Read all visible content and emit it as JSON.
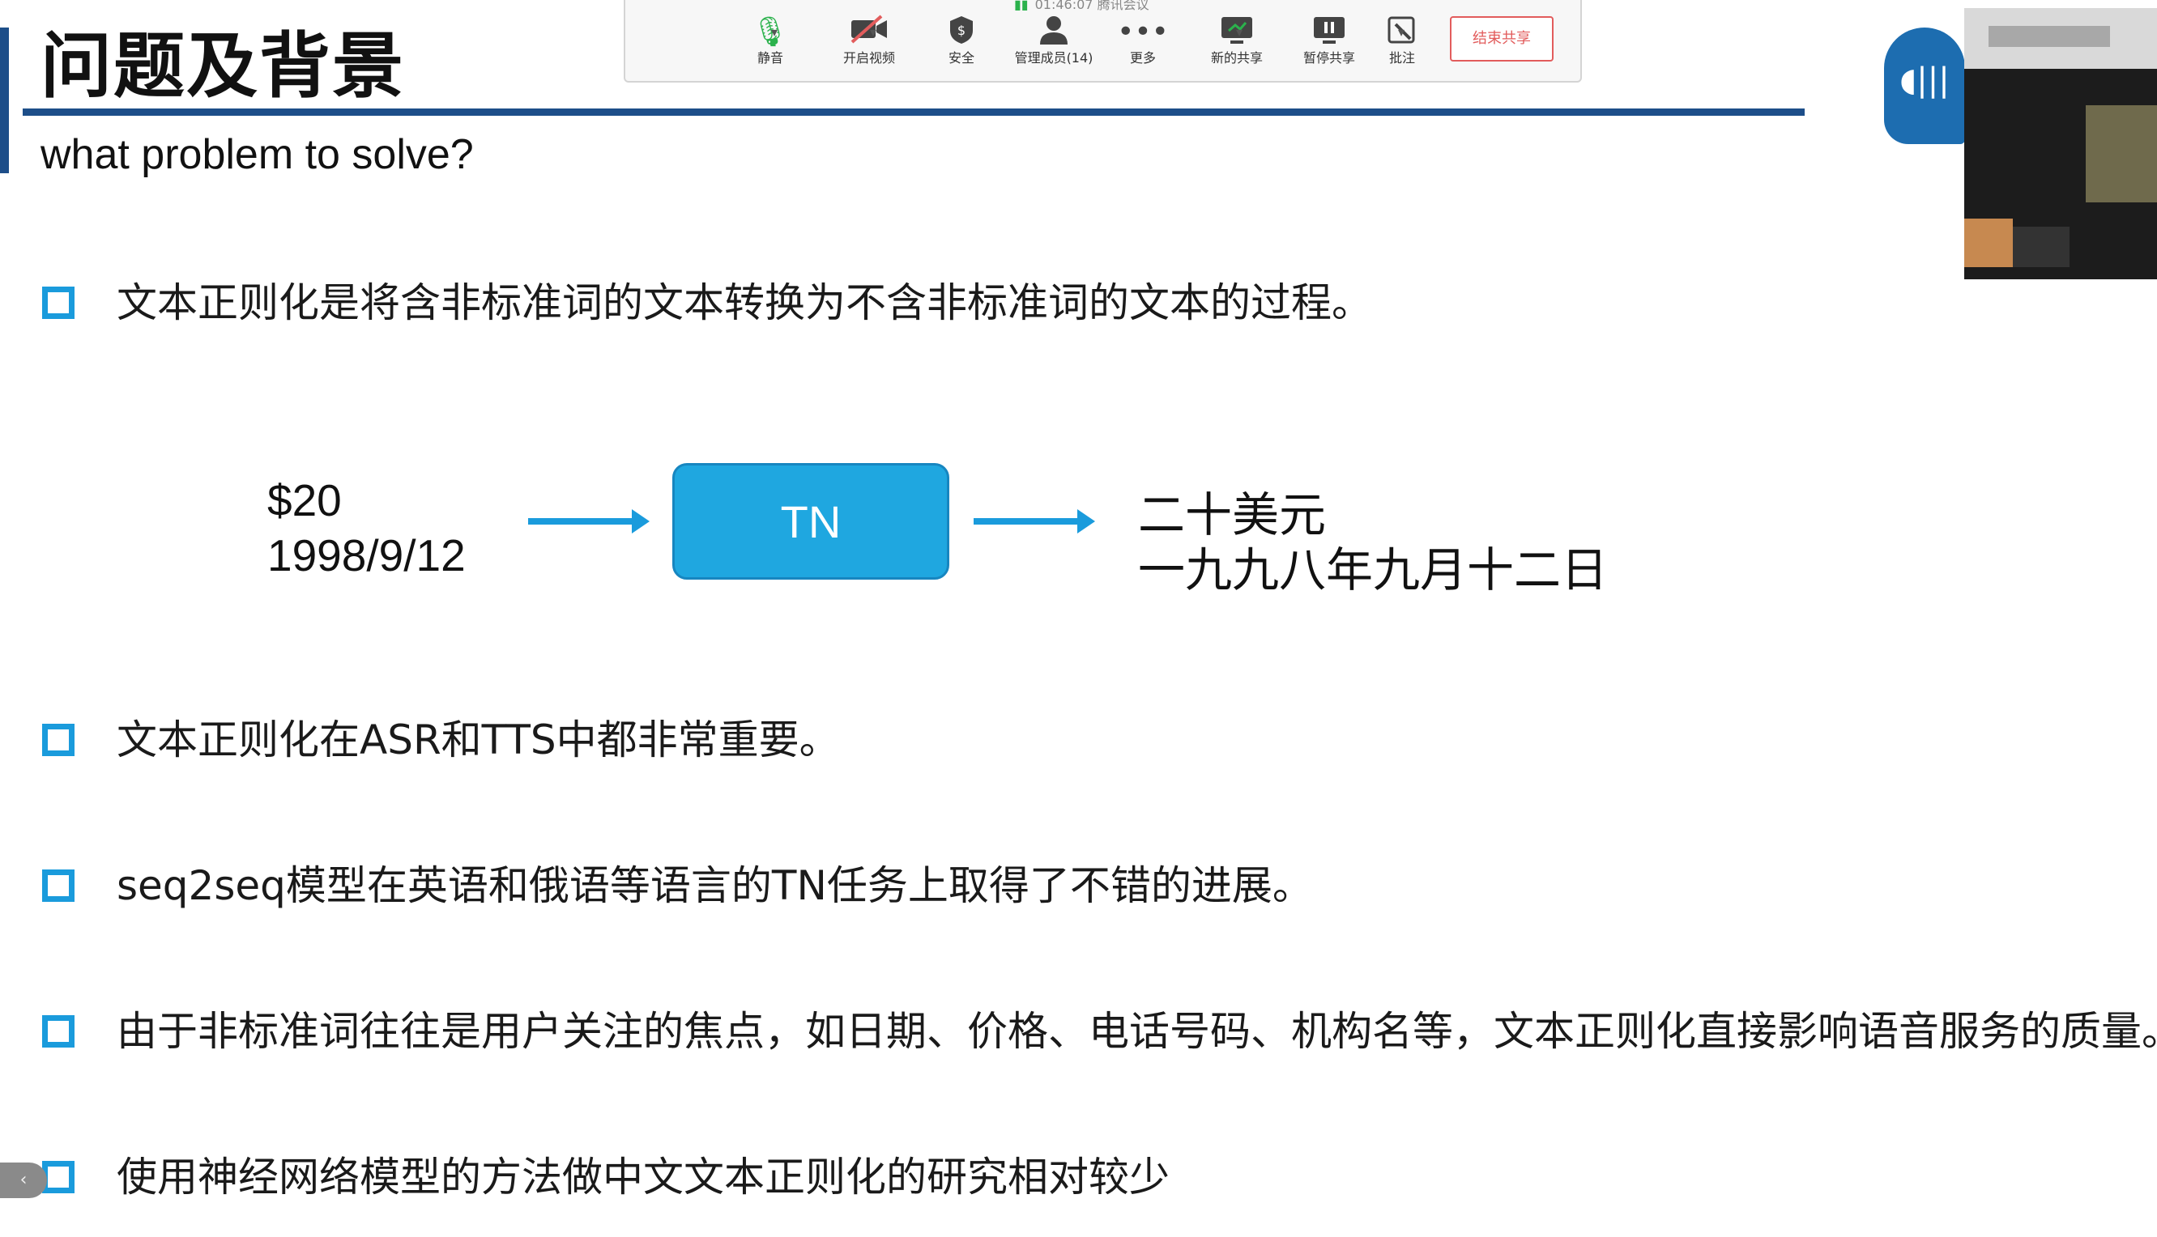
{
  "slide": {
    "title": "问题及背景",
    "subtitle": "what problem to solve?",
    "bullets": [
      "文本正则化是将含非标准词的文本转换为不含非标准词的文本的过程。",
      "文本正则化在ASR和TTS中都非常重要。",
      "seq2seq模型在英语和俄语等语言的TN任务上取得了不错的进展。",
      "由于非标准词往往是用户关注的焦点，如日期、价格、电话号码、机构名等，文本正则化直接影响语音服务的质量。",
      "使用神经网络模型的方法做中文文本正则化的研究相对较少"
    ],
    "diagram": {
      "inputs": [
        "$20",
        "1998/9/12"
      ],
      "box_label": "TN",
      "outputs": [
        "二十美元",
        "一九九八年九月十二日"
      ]
    }
  },
  "toolbar": {
    "timer": "01:46:07",
    "meeting_name": "腾讯会议",
    "items": {
      "mute": {
        "label": "静音",
        "icon": "microphone-icon"
      },
      "video": {
        "label": "开启视频",
        "icon": "video-off-icon"
      },
      "security": {
        "label": "安全",
        "icon": "shield-icon"
      },
      "members": {
        "label": "管理成员(14)",
        "icon": "person-icon"
      },
      "more": {
        "label": "更多",
        "icon": "more-icon"
      },
      "new_share": {
        "label": "新的共享",
        "icon": "screen-share-icon"
      },
      "pause_share": {
        "label": "暂停共享",
        "icon": "pause-icon"
      },
      "annotate": {
        "label": "批注",
        "icon": "annotate-icon"
      }
    },
    "end_share_label": "结束共享"
  },
  "colors": {
    "accent_blue": "#1a9bdc",
    "title_rule": "#1d4e89",
    "end_button": "#e25c5c",
    "mic_green": "#2bb24c"
  }
}
